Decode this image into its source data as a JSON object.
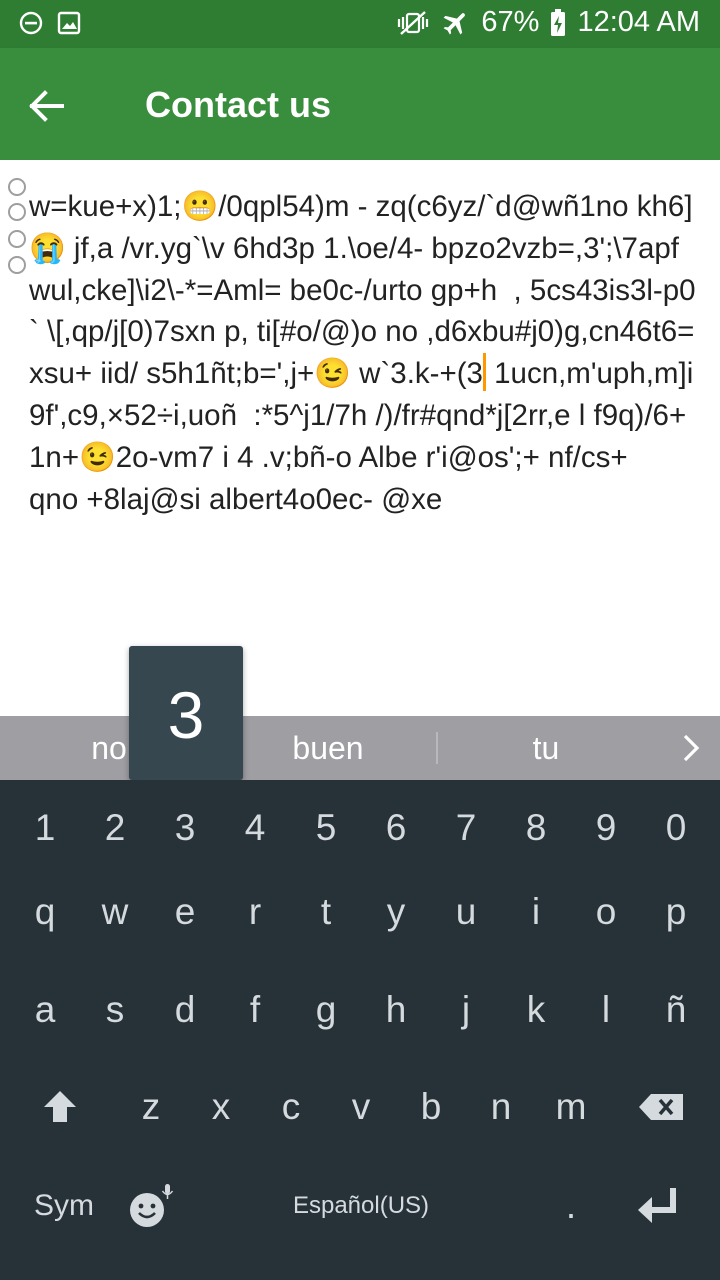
{
  "status_bar": {
    "battery": "67%",
    "time": "12:04 AM",
    "icons": [
      "dnd-icon",
      "image-notification-icon",
      "vibrate-icon",
      "airplane-icon",
      "battery-charging-icon"
    ]
  },
  "app_bar": {
    "title": "Contact us",
    "back_icon": "arrow-back-icon"
  },
  "message": {
    "before_cursor": "w=kue+x)1;😬/0qpl54)m - zq(c6yz/`d@wñ1no kh6]😭 jf,a /vr.yg`\\v 6hd3p 1.\\oe/4- bpzo2vzb=,3';\\7apf wul,cke]\\i2\\-*=Aml= be0c-/urto gp+h  , 5cs43is3l-p0 ` \\[,qp/j[0)7sxn p, ti[#o/@)o no ,d6xbu#j0)g,cn46t6=xsu+ iid/ s5h1ñt;b=',j+😉 w`3.k-+(3",
    "after_cursor": " 1ucn,m'uph,m]i9f',c9,×52÷i,uoñ  :*5^j1/7h /)/fr#qnd*j[2rr,e l f9q)/6+1n+😉2o-vm7 i 4 .v;bñ-o Albe r'i@os';+ nf/cs+        qno +8laj@si albert4o0ec- @xe"
  },
  "suggestions": [
    "no",
    "buen",
    "tu"
  ],
  "key_preview": "3",
  "keyboard": {
    "number_row": [
      "1",
      "2",
      "3",
      "4",
      "5",
      "6",
      "7",
      "8",
      "9",
      "0"
    ],
    "row1": [
      "q",
      "w",
      "e",
      "r",
      "t",
      "y",
      "u",
      "i",
      "o",
      "p"
    ],
    "row2": [
      "a",
      "s",
      "d",
      "f",
      "g",
      "h",
      "j",
      "k",
      "l",
      "ñ"
    ],
    "row3": [
      "z",
      "x",
      "c",
      "v",
      "b",
      "n",
      "m"
    ],
    "sym_label": "Sym",
    "space_label": "Español(US)",
    "period": ".",
    "icons": [
      "shift-icon",
      "backspace-icon",
      "emoji-icon",
      "mic-icon",
      "enter-icon"
    ]
  },
  "colors": {
    "status_bar": "#2e7d32",
    "app_bar": "#388e3c",
    "keyboard": "#263238",
    "suggestion_strip": "#9e9ea3",
    "cursor": "#ff9800"
  }
}
